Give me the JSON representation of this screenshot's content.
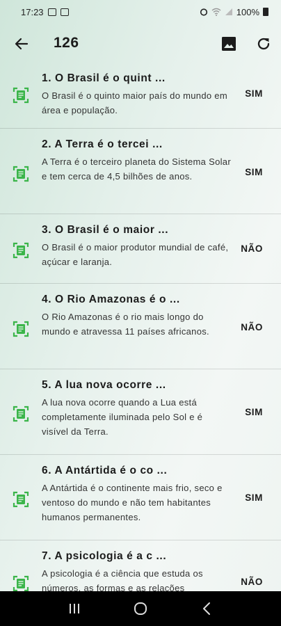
{
  "status_bar": {
    "time": "17:23",
    "battery": "100%",
    "icons": [
      "image-icon",
      "sim-icon",
      "alarm-icon",
      "wifi-icon",
      "signal-icon",
      "battery-icon"
    ]
  },
  "app_bar": {
    "title": "126",
    "back_icon": "arrow-left-icon",
    "image_icon": "image-icon",
    "refresh_icon": "refresh-icon"
  },
  "items": [
    {
      "title": "1. O Brasil é o quint ...",
      "description": "O Brasil é o quinto maior país do mundo em área e população.",
      "answer": "SIM"
    },
    {
      "title": "2. A Terra é o tercei ...",
      "description": "A Terra é o terceiro planeta do Sistema Solar e tem cerca de 4,5 bilhões de anos.",
      "answer": "SIM"
    },
    {
      "title": "3. O Brasil é o maior ...",
      "description": "O Brasil é o maior produtor mundial de café, açúcar e laranja.",
      "answer": "NÃO"
    },
    {
      "title": "4. O Rio Amazonas é o ...",
      "description": "O Rio Amazonas é o rio mais longo do mundo e atravessa 11 países africanos.",
      "answer": "NÃO"
    },
    {
      "title": "5. A lua nova ocorre  ...",
      "description": "A lua nova ocorre quando a Lua está completamente iluminada pelo Sol e é visível da Terra.",
      "answer": "SIM"
    },
    {
      "title": "6. A Antártida é o co ...",
      "description": "A Antártida é o continente mais frio, seco e ventoso do mundo e não tem habitantes humanos permanentes.",
      "answer": "SIM"
    },
    {
      "title": "7. A psicologia é a c ...",
      "description": "A psicologia é a ciência que estuda os números, as formas e as relações",
      "answer": "NÃO"
    }
  ],
  "colors": {
    "accent_green": "#3bb54a",
    "nav_bar": "#000000"
  }
}
